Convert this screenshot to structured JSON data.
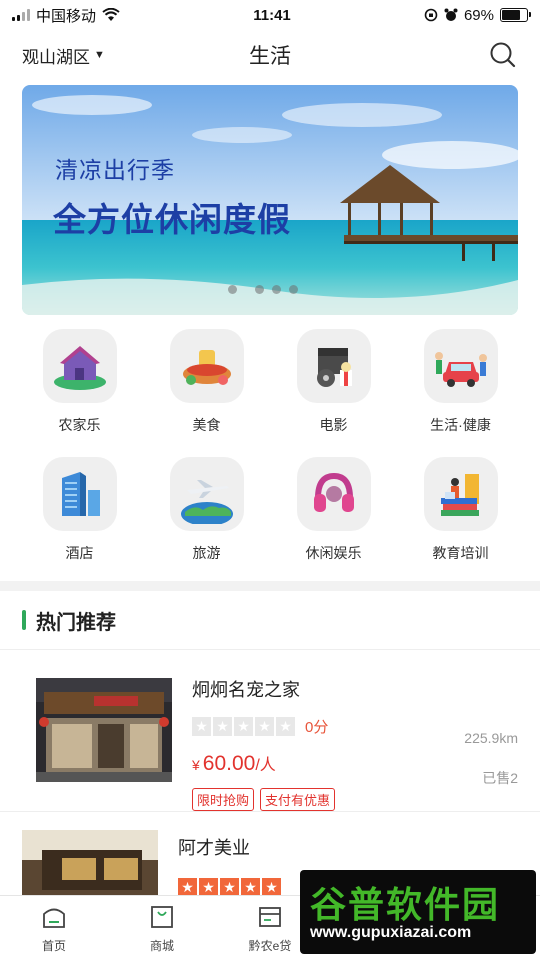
{
  "status_bar": {
    "carrier": "中国移动",
    "time": "11:41",
    "battery": "69%"
  },
  "nav": {
    "location": "观山湖区",
    "title": "生活"
  },
  "banner": {
    "subtitle": "清凉出行季",
    "title": "全方位休闲度假"
  },
  "categories": [
    {
      "label": "农家乐",
      "icon": "farmhouse-icon"
    },
    {
      "label": "美食",
      "icon": "hotpot-icon"
    },
    {
      "label": "电影",
      "icon": "movie-icon"
    },
    {
      "label": "生活·健康",
      "icon": "car-wash-icon"
    },
    {
      "label": "酒店",
      "icon": "hotel-building-icon"
    },
    {
      "label": "旅游",
      "icon": "airplane-globe-icon"
    },
    {
      "label": "休闲娱乐",
      "icon": "headphones-icon"
    },
    {
      "label": "教育培训",
      "icon": "books-icon"
    }
  ],
  "section": {
    "title": "热门推荐"
  },
  "items": [
    {
      "name": "炯炯名宠之家",
      "rating": 0,
      "score": "0分",
      "distance": "225.9km",
      "price_symbol": "¥",
      "price": "60.00",
      "price_unit": "/人",
      "sold": "已售2",
      "tags": [
        "限时抢购",
        "支付有优惠"
      ]
    },
    {
      "name": "阿才美业",
      "rating": 5
    }
  ],
  "tabbar": [
    {
      "label": "首页",
      "icon": "home-icon"
    },
    {
      "label": "商城",
      "icon": "shopping-bag-icon"
    },
    {
      "label": "黔农e贷",
      "icon": "card-icon"
    }
  ],
  "watermark": {
    "title": "谷普软件园",
    "url": "www.gupuxiazai.com"
  },
  "colors": {
    "accent_green": "#2fa85a",
    "price_red": "#e2332e",
    "star_orange": "#f1673a",
    "banner_text": "#1d3fa5"
  }
}
